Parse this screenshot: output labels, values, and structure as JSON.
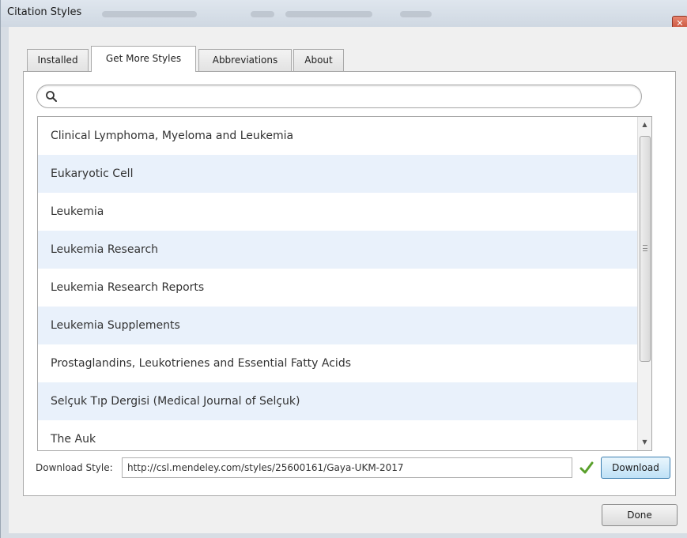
{
  "window": {
    "title": "Citation Styles"
  },
  "tabs": [
    {
      "label": "Installed",
      "active": false
    },
    {
      "label": "Get More Styles",
      "active": true
    },
    {
      "label": "Abbreviations",
      "active": false
    },
    {
      "label": "About",
      "active": false
    }
  ],
  "search": {
    "value": "",
    "placeholder": "",
    "icon": "search-icon"
  },
  "styles_list": [
    "Clinical Lymphoma, Myeloma and Leukemia",
    "Eukaryotic Cell",
    "Leukemia",
    "Leukemia Research",
    "Leukemia Research Reports",
    "Leukemia Supplements",
    "Prostaglandins, Leukotrienes and Essential Fatty Acids",
    "Selçuk Tıp Dergisi (Medical Journal of Selçuk)",
    "The Auk"
  ],
  "download": {
    "label": "Download Style:",
    "url": "http://csl.mendeley.com/styles/25600161/Gaya-UKM-2017",
    "valid_icon": "check-icon",
    "button_label": "Download"
  },
  "footer": {
    "done_label": "Done"
  },
  "colors": {
    "alt_row": "#e9f1fb",
    "check_green": "#5aa02c",
    "download_border": "#3c7fb1"
  }
}
